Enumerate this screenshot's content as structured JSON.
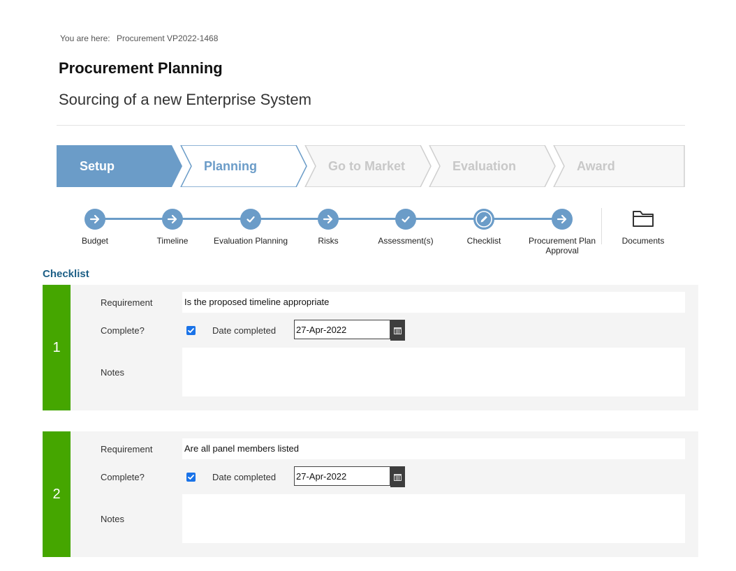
{
  "breadcrumb": {
    "prefix": "You are here:",
    "item": "Procurement VP2022-1468"
  },
  "page": {
    "title": "Procurement Planning",
    "subtitle": "Sourcing of a new Enterprise System"
  },
  "stages": [
    {
      "label": "Setup",
      "state": "active"
    },
    {
      "label": "Planning",
      "state": "current"
    },
    {
      "label": "Go to Market",
      "state": "inactive"
    },
    {
      "label": "Evaluation",
      "state": "inactive"
    },
    {
      "label": "Award",
      "state": "inactive"
    }
  ],
  "steps": [
    {
      "label": "Budget",
      "icon": "arrow-right-icon"
    },
    {
      "label": "Timeline",
      "icon": "arrow-right-icon"
    },
    {
      "label": "Evaluation Planning",
      "icon": "check-icon"
    },
    {
      "label": "Risks",
      "icon": "arrow-right-icon"
    },
    {
      "label": "Assessment(s)",
      "icon": "check-icon"
    },
    {
      "label": "Checklist",
      "icon": "pencil-icon"
    },
    {
      "label": "Procurement Plan Approval",
      "icon": "arrow-right-icon"
    },
    {
      "label": "Documents",
      "icon": "folder-icon"
    }
  ],
  "section": {
    "title": "Checklist"
  },
  "labels": {
    "requirement": "Requirement",
    "complete": "Complete?",
    "date_completed": "Date completed",
    "notes": "Notes"
  },
  "checklist": [
    {
      "number": "1",
      "requirement": "Is the proposed timeline appropriate",
      "complete": true,
      "date": "27-Apr-2022",
      "notes": ""
    },
    {
      "number": "2",
      "requirement": "Are all panel members listed",
      "complete": true,
      "date": "27-Apr-2022",
      "notes": ""
    }
  ],
  "colors": {
    "accent": "#6b9cc8",
    "stage_current_text": "#6b9cc8",
    "stage_inactive_text": "#c8c8c8",
    "number_bar": "#45a600",
    "section_title": "#1d5f86"
  }
}
